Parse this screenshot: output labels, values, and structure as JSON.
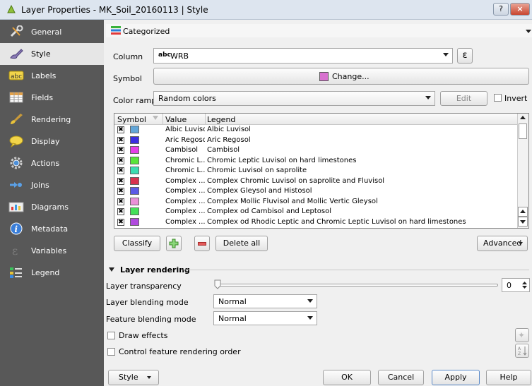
{
  "window": {
    "title": "Layer Properties - MK_Soil_20160113 | Style",
    "help_button": "?",
    "close_button": "×"
  },
  "sidebar": {
    "items": [
      {
        "label": "General",
        "icon": "wrench-icon"
      },
      {
        "label": "Style",
        "icon": "brush-icon"
      },
      {
        "label": "Labels",
        "icon": "abc-label-icon"
      },
      {
        "label": "Fields",
        "icon": "table-icon"
      },
      {
        "label": "Rendering",
        "icon": "paintbrush-icon"
      },
      {
        "label": "Display",
        "icon": "speech-bubble-icon"
      },
      {
        "label": "Actions",
        "icon": "gear-icon"
      },
      {
        "label": "Joins",
        "icon": "join-icon"
      },
      {
        "label": "Diagrams",
        "icon": "diagram-icon"
      },
      {
        "label": "Metadata",
        "icon": "info-icon"
      },
      {
        "label": "Variables",
        "icon": "epsilon-icon"
      },
      {
        "label": "Legend",
        "icon": "legend-icon"
      }
    ],
    "active": "Style"
  },
  "renderer": {
    "selected": "Categorized"
  },
  "column": {
    "label": "Column",
    "prefix": "abc",
    "value": "WRB",
    "expression_button": "ε"
  },
  "symbol": {
    "label": "Symbol",
    "change_button": "Change..."
  },
  "color_ramp": {
    "label": "Color ramp",
    "value": "Random colors",
    "edit_button": "Edit",
    "invert_label": "Invert"
  },
  "table": {
    "headers": [
      "Symbol",
      "Value",
      "Legend"
    ],
    "rows": [
      {
        "color": "#62a6d8",
        "value": "Albic Luvisol",
        "legend": "Albic Luvisol"
      },
      {
        "color": "#3b2ee0",
        "value": "Aric Regosol",
        "legend": "Aric Regosol"
      },
      {
        "color": "#e43ee7",
        "value": "Cambisol",
        "legend": "Cambisol"
      },
      {
        "color": "#59e43a",
        "value": "Chromic L...",
        "legend": "Chromic Leptic Luvisol on hard limestones"
      },
      {
        "color": "#3cdcb1",
        "value": "Chromic L...",
        "legend": "Chromic Luvisol on saprolite"
      },
      {
        "color": "#d8324f",
        "value": "Complex ...",
        "legend": "Complex Chromic Luvisol on saprolite and Fluvisol"
      },
      {
        "color": "#5c5ae6",
        "value": "Complex ...",
        "legend": "Complex Gleysol and Histosol"
      },
      {
        "color": "#ea8fd8",
        "value": "Complex ...",
        "legend": "Complex Mollic Fluvisol and Mollic Vertic Gleysol"
      },
      {
        "color": "#45e05a",
        "value": "Complex ...",
        "legend": "Complex od Cambisol and Leptosol"
      },
      {
        "color": "#b04ade",
        "value": "Complex ...",
        "legend": "Complex od Rhodic Leptic and Chromic Leptic Luvisol on hard limestones"
      }
    ]
  },
  "actions": {
    "classify": "Classify",
    "delete_all": "Delete all",
    "advanced": "Advanced"
  },
  "layer_rendering": {
    "title": "Layer rendering",
    "transparency_label": "Layer transparency",
    "transparency_value": "0",
    "transparency_level": 0,
    "layer_blending_label": "Layer blending mode",
    "layer_blending_value": "Normal",
    "feature_blending_label": "Feature blending mode",
    "feature_blending_value": "Normal",
    "draw_effects_label": "Draw effects",
    "control_order_label": "Control feature rendering order"
  },
  "footer": {
    "style": "Style",
    "ok": "OK",
    "cancel": "Cancel",
    "apply": "Apply",
    "help": "Help"
  },
  "colors": {
    "sidebar_bg": "#585858",
    "active_item_bg": "#e6e6e6",
    "symbol_preview": "#d871cf"
  }
}
